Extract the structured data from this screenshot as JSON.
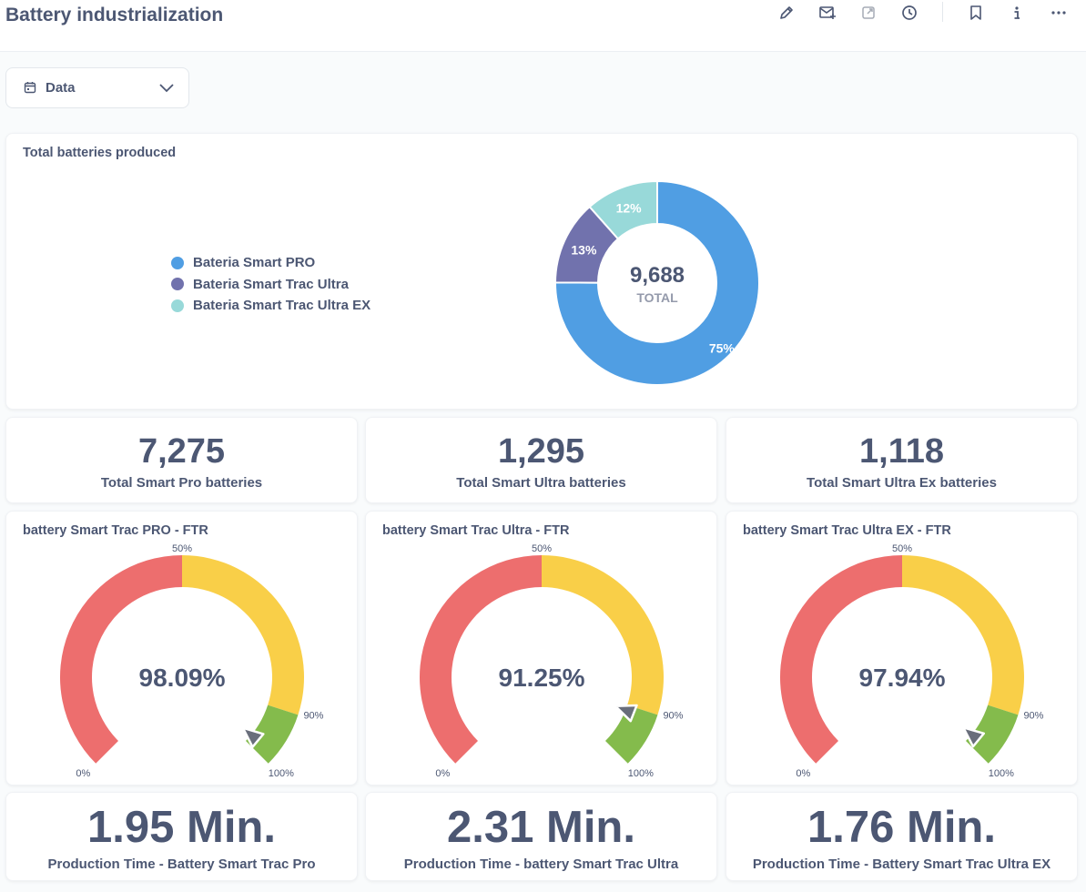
{
  "header": {
    "title": "Battery industrialization",
    "actions": [
      "pencil-icon",
      "subscribe-icon",
      "share-icon",
      "history-icon",
      "bookmark-icon",
      "info-icon",
      "more-icon"
    ]
  },
  "filter": {
    "label": "Data",
    "icon": "calendar-icon"
  },
  "donut_card": {
    "title": "Total batteries produced",
    "total_value": "9,688",
    "total_label": "TOTAL",
    "legend": [
      "Bateria Smart PRO",
      "Bateria Smart Trac Ultra",
      "Bateria Smart Trac Ultra EX"
    ],
    "colors": [
      "#509ee3",
      "#7172ad",
      "#98d9d9"
    ]
  },
  "scalars": [
    {
      "value": "7,275",
      "label": "Total Smart Pro batteries"
    },
    {
      "value": "1,295",
      "label": "Total Smart Ultra batteries"
    },
    {
      "value": "1,118",
      "label": "Total Smart Ultra Ex batteries"
    }
  ],
  "gauges": [
    {
      "title": "battery Smart Trac PRO - FTR",
      "value_text": "98.09%",
      "value": 98.09
    },
    {
      "title": "battery Smart Trac Ultra - FTR",
      "value_text": "91.25%",
      "value": 91.25
    },
    {
      "title": "battery Smart Trac Ultra EX - FTR",
      "value_text": "97.94%",
      "value": 97.94
    }
  ],
  "gauge_ticks": [
    "0%",
    "50%",
    "90%",
    "100%"
  ],
  "gauge_colors": {
    "red": "#ed6e6e",
    "yellow": "#f9cf48",
    "green": "#84bb4c",
    "pointer": "#696e7b"
  },
  "times": [
    {
      "value": "1.95 Min.",
      "label": "Production Time - Battery Smart Trac Pro"
    },
    {
      "value": "2.31 Min.",
      "label": "Production Time - battery Smart Trac Ultra"
    },
    {
      "value": "1.76 Min.",
      "label": "Production Time - Battery Smart Trac Ultra EX"
    }
  ],
  "chart_data": [
    {
      "type": "pie",
      "title": "Total batteries produced",
      "categories": [
        "Bateria Smart PRO",
        "Bateria Smart Trac Ultra",
        "Bateria Smart Trac Ultra EX"
      ],
      "values": [
        7275,
        1295,
        1118
      ],
      "percent_labels": [
        "75%",
        "13%",
        "12%"
      ],
      "total": "9,688"
    }
  ]
}
